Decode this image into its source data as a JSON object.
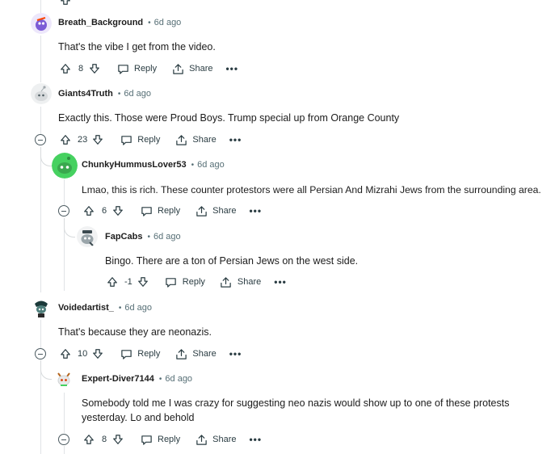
{
  "comments": [
    {
      "author": "Breath_Background",
      "time": "6d ago",
      "text": "That's the vibe I get from the video.",
      "score": "8",
      "reply_label": "Reply",
      "share_label": "Share",
      "more_label": "•••"
    },
    {
      "author": "Giants4Truth",
      "time": "6d ago",
      "text": "Exactly this. Those were Proud Boys. Trump special up from Orange County",
      "score": "23",
      "reply_label": "Reply",
      "share_label": "Share",
      "more_label": "•••"
    },
    {
      "author": "ChunkyHummusLover53",
      "time": "6d ago",
      "text": "Lmao, this is rich. These counter protestors were all Persian And Mizrahi Jews from the surrounding area.",
      "score": "6",
      "reply_label": "Reply",
      "share_label": "Share",
      "more_label": "•••"
    },
    {
      "author": "FapCabs",
      "time": "6d ago",
      "text": "Bingo. There are a ton of Persian Jews on the west side.",
      "score": "-1",
      "reply_label": "Reply",
      "share_label": "Share",
      "more_label": "•••"
    },
    {
      "author": "Voidedartist_",
      "time": "6d ago",
      "text": "That's because they are neonazis.",
      "score": "10",
      "reply_label": "Reply",
      "share_label": "Share",
      "more_label": "•••"
    },
    {
      "author": "Expert-Diver7144",
      "time": "6d ago",
      "text": "Somebody told me I was crazy for suggesting neo nazis would show up to one of these protests yesterday. Lo and behold",
      "score": "8",
      "reply_label": "Reply",
      "share_label": "Share",
      "more_label": "•••"
    }
  ],
  "separator": "•",
  "icons": {
    "upvote": "upvote-icon",
    "downvote": "downvote-icon",
    "reply": "reply-icon",
    "share": "share-icon",
    "more": "more-icon",
    "collapse": "collapse-thread-icon"
  },
  "colors": {
    "text": "#1c1c1c",
    "meta": "#576f76",
    "thread_line": "#e0e3e6",
    "avatar_green": "#46d160"
  }
}
